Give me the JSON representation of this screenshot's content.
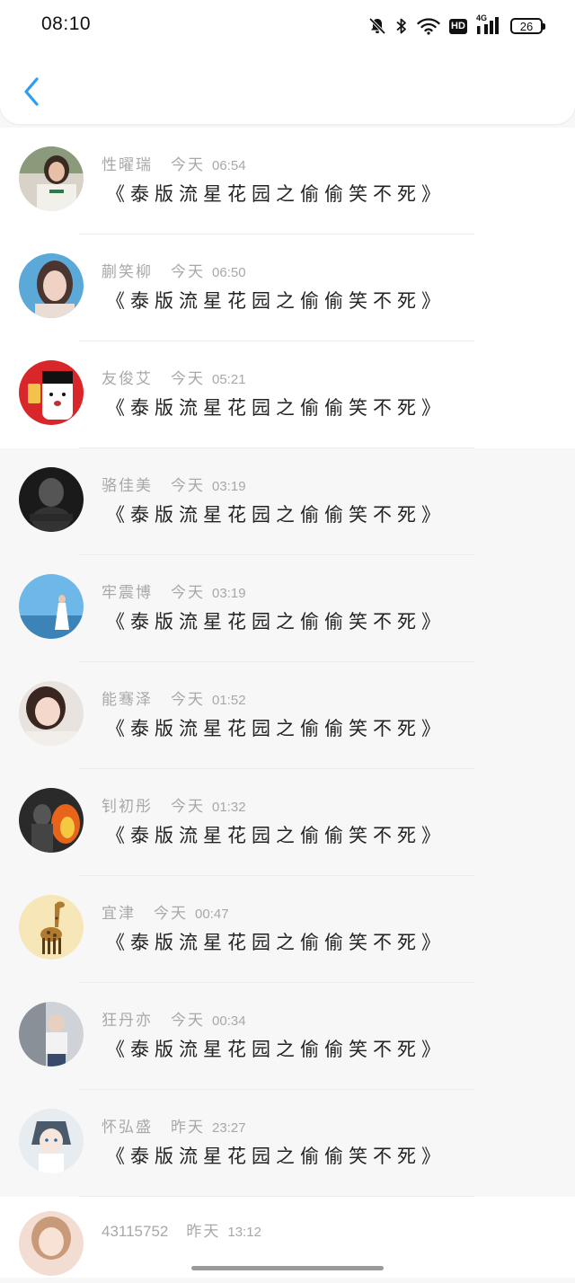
{
  "status_bar": {
    "time": "08:10",
    "network_4g": "4G",
    "hd": "HD",
    "battery": "26"
  },
  "header": {
    "back_icon": "chevron-left-icon",
    "accent_color": "#2b9df5"
  },
  "messages": [
    {
      "name": "性曜瑞",
      "day": "今天",
      "time": "06:54",
      "text": "《泰版流星花园之偷偷笑不死》"
    },
    {
      "name": "蒯笑柳",
      "day": "今天",
      "time": "06:50",
      "text": "《泰版流星花园之偷偷笑不死》"
    },
    {
      "name": "友俊艾",
      "day": "今天",
      "time": "05:21",
      "text": "《泰版流星花园之偷偷笑不死》"
    },
    {
      "name": "骆佳美",
      "day": "今天",
      "time": "03:19",
      "text": "《泰版流星花园之偷偷笑不死》"
    },
    {
      "name": "牢震博",
      "day": "今天",
      "time": "03:19",
      "text": "《泰版流星花园之偷偷笑不死》"
    },
    {
      "name": "能骞泽",
      "day": "今天",
      "time": "01:52",
      "text": "《泰版流星花园之偷偷笑不死》"
    },
    {
      "name": "钊初彤",
      "day": "今天",
      "time": "01:32",
      "text": "《泰版流星花园之偷偷笑不死》"
    },
    {
      "name": "宜津",
      "day": "今天",
      "time": "00:47",
      "text": "《泰版流星花园之偷偷笑不死》"
    },
    {
      "name": "狂丹亦",
      "day": "今天",
      "time": "00:34",
      "text": "《泰版流星花园之偷偷笑不死》"
    },
    {
      "name": "怀弘盛",
      "day": "昨天",
      "time": "23:27",
      "text": "《泰版流星花园之偷偷笑不死》"
    },
    {
      "name": "43115752",
      "day": "昨天",
      "time": "13:12"
    }
  ]
}
